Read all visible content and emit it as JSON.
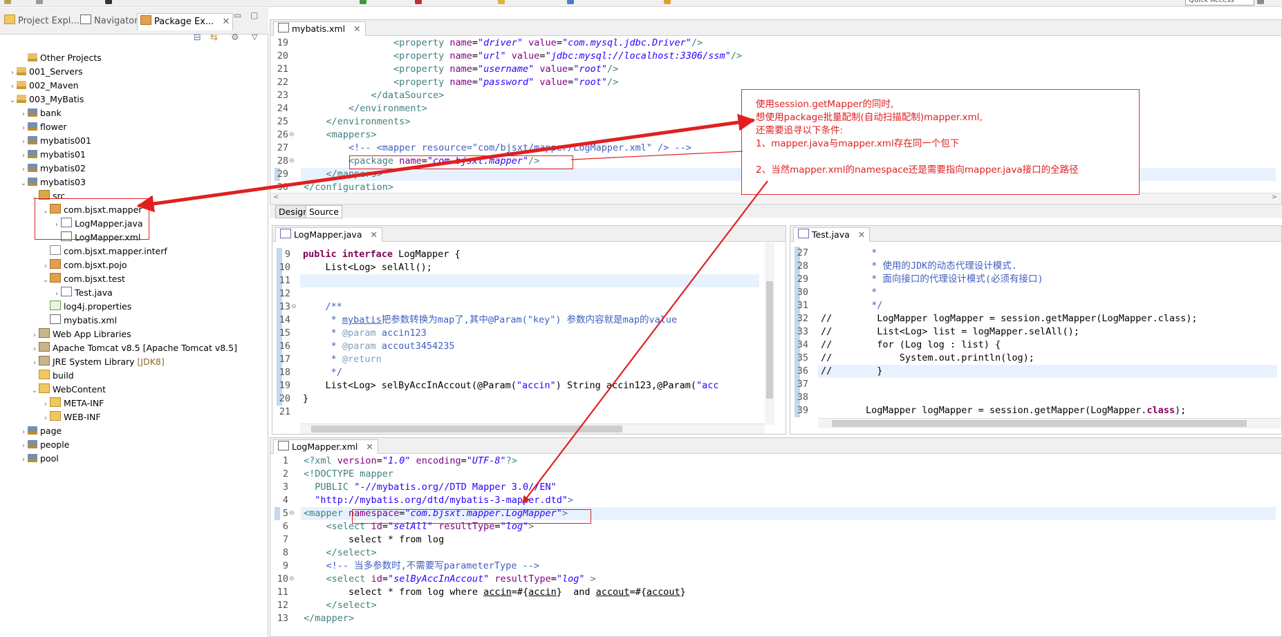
{
  "toolbar": {
    "quick_access": "Quick Access"
  },
  "left_panel": {
    "tabs": [
      {
        "label": "Project Expl...",
        "active": false
      },
      {
        "label": "Navigator",
        "active": false
      },
      {
        "label": "Package Ex...",
        "active": true
      }
    ],
    "tree": [
      {
        "label": "Other Projects",
        "depth": 1,
        "expand": "",
        "icon": "working-set-icon"
      },
      {
        "label": "001_Servers",
        "depth": 0,
        "expand": ">",
        "icon": "project-folder-icon"
      },
      {
        "label": "002_Maven",
        "depth": 0,
        "expand": ">",
        "icon": "project-folder-icon"
      },
      {
        "label": "003_MyBatis",
        "depth": 0,
        "expand": "v",
        "icon": "project-folder-icon"
      },
      {
        "label": "bank",
        "depth": 1,
        "expand": ">",
        "icon": "java-project-icon"
      },
      {
        "label": "flower",
        "depth": 1,
        "expand": ">",
        "icon": "java-project-icon"
      },
      {
        "label": "mybatis001",
        "depth": 1,
        "expand": ">",
        "icon": "java-project-icon"
      },
      {
        "label": "mybatis01",
        "depth": 1,
        "expand": ">",
        "icon": "java-project-icon"
      },
      {
        "label": "mybatis02",
        "depth": 1,
        "expand": ">",
        "icon": "java-project-icon"
      },
      {
        "label": "mybatis03",
        "depth": 1,
        "expand": "v",
        "icon": "java-project-icon"
      },
      {
        "label": "src",
        "depth": 2,
        "expand": "v",
        "icon": "source-folder-icon"
      },
      {
        "label": "com.bjsxt.mapper",
        "depth": 3,
        "expand": "v",
        "icon": "package-icon"
      },
      {
        "label": "LogMapper.java",
        "depth": 4,
        "expand": ">",
        "icon": "java-file-icon"
      },
      {
        "label": "LogMapper.xml",
        "depth": 4,
        "expand": "",
        "icon": "xml-file-icon"
      },
      {
        "label": "com.bjsxt.mapper.interf",
        "depth": 3,
        "expand": "",
        "icon": "empty-package-icon"
      },
      {
        "label": "com.bjsxt.pojo",
        "depth": 3,
        "expand": ">",
        "icon": "package-icon"
      },
      {
        "label": "com.bjsxt.test",
        "depth": 3,
        "expand": "v",
        "icon": "package-icon"
      },
      {
        "label": "Test.java",
        "depth": 4,
        "expand": ">",
        "icon": "java-file-icon"
      },
      {
        "label": "log4j.properties",
        "depth": 3,
        "expand": "",
        "icon": "properties-file-icon"
      },
      {
        "label": "mybatis.xml",
        "depth": 3,
        "expand": "",
        "icon": "xml-file-icon"
      },
      {
        "label": "Web App Libraries",
        "depth": 2,
        "expand": ">",
        "icon": "library-icon"
      },
      {
        "label": "Apache Tomcat v8.5 [Apache Tomcat v8.5]",
        "depth": 2,
        "expand": ">",
        "icon": "library-icon"
      },
      {
        "label": "JRE System Library",
        "suffix": "[JDK8]",
        "depth": 2,
        "expand": ">",
        "icon": "library-icon"
      },
      {
        "label": "build",
        "depth": 2,
        "expand": "",
        "icon": "folder-icon"
      },
      {
        "label": "WebContent",
        "depth": 2,
        "expand": "v",
        "icon": "folder-icon"
      },
      {
        "label": "META-INF",
        "depth": 3,
        "expand": ">",
        "icon": "folder-icon"
      },
      {
        "label": "WEB-INF",
        "depth": 3,
        "expand": ">",
        "icon": "folder-icon"
      },
      {
        "label": "page",
        "depth": 1,
        "expand": ">",
        "icon": "java-project-icon"
      },
      {
        "label": "people",
        "depth": 1,
        "expand": ">",
        "icon": "java-project-icon"
      },
      {
        "label": "pool",
        "depth": 1,
        "expand": ">",
        "icon": "java-project-icon"
      }
    ]
  },
  "editors": {
    "mybatis_xml": {
      "tab": "mybatis.xml",
      "lines": [
        {
          "n": "19",
          "html": "                <span class=\"tag\">&lt;property</span> <span class=\"attr\">name</span>=<span class=\"str\">\"driver\"</span> <span class=\"attr\">value</span>=<span class=\"str\">\"com.mysql.jdbc.Driver\"</span><span class=\"tag\">/&gt;</span>"
        },
        {
          "n": "20",
          "html": "                <span class=\"tag\">&lt;property</span> <span class=\"attr\">name</span>=<span class=\"str\">\"url\"</span> <span class=\"attr\">value</span>=<span class=\"str\">\"jdbc:mysql://localhost:3306/ssm\"</span><span class=\"tag\">/&gt;</span>"
        },
        {
          "n": "21",
          "html": "                <span class=\"tag\">&lt;property</span> <span class=\"attr\">name</span>=<span class=\"str\">\"username\"</span> <span class=\"attr\">value</span>=<span class=\"str\">\"root\"</span><span class=\"tag\">/&gt;</span>"
        },
        {
          "n": "22",
          "html": "                <span class=\"tag\">&lt;property</span> <span class=\"attr\">name</span>=<span class=\"str\">\"password\"</span> <span class=\"attr\">value</span>=<span class=\"str\">\"root\"</span><span class=\"tag\">/&gt;</span>"
        },
        {
          "n": "23",
          "html": "            <span class=\"tag\">&lt;/dataSource&gt;</span>"
        },
        {
          "n": "24",
          "html": "        <span class=\"tag\">&lt;/environment&gt;</span>"
        },
        {
          "n": "25",
          "html": "    <span class=\"tag\">&lt;/environments&gt;</span>"
        },
        {
          "n": "26",
          "html": "    <span class=\"tag\">&lt;mappers&gt;</span>"
        },
        {
          "n": "27",
          "html": "        <span class=\"xmlcmt\">&lt;!-- &lt;mapper resource=\"com/bjsxt/mapper/LogMapper.xml\" /&gt; --&gt;</span>"
        },
        {
          "n": "28",
          "html": "        <span class=\"tag\">&lt;package</span> <span class=\"attr\">name</span>=<span class=\"str\">\"com.bjsxt.mapper\"</span><span class=\"tag\">/&gt;</span>"
        },
        {
          "n": "29",
          "html": "    <span class=\"tag\">&lt;/mappers&gt;</span>"
        },
        {
          "n": "30",
          "html": "<span class=\"tag\">&lt;/configuration&gt;</span>"
        }
      ]
    },
    "bottom_tabs": [
      "Design",
      "Source"
    ],
    "logmapper_java": {
      "tab": "LogMapper.java",
      "lines": [
        {
          "n": "9",
          "html": "<span class=\"kw\">public interface</span> LogMapper {"
        },
        {
          "n": "10",
          "html": "    List&lt;Log&gt; selAll();"
        },
        {
          "n": "11",
          "html": ""
        },
        {
          "n": "12",
          "html": ""
        },
        {
          "n": "13",
          "html": "    <span class=\"cmt\">/**</span>"
        },
        {
          "n": "14",
          "html": "<span class=\"cmt\">     * <u>mybatis</u>把参数转换为map了,其中@Param(\"key\") 参数内容就是map的value</span>"
        },
        {
          "n": "15",
          "html": "<span class=\"cmt\">     * <b style=\"color:#7f9fbf;font-weight:normal\">@param</b> accin123</span>"
        },
        {
          "n": "16",
          "html": "<span class=\"cmt\">     * <b style=\"color:#7f9fbf;font-weight:normal\">@param</b> accout3454235</span>"
        },
        {
          "n": "17",
          "html": "<span class=\"cmt\">     * <b style=\"color:#7f9fbf;font-weight:normal\">@return</b></span>"
        },
        {
          "n": "18",
          "html": "<span class=\"cmt\">     */</span>"
        },
        {
          "n": "19",
          "html": "    List&lt;Log&gt; selByAccInAccout(@Param(<span class=\"str\" style=\"font-style:normal\">\"accin\"</span>) String accin123,@Param(<span class=\"str\" style=\"font-style:normal\">\"acc</span>"
        },
        {
          "n": "20",
          "html": "}"
        },
        {
          "n": "21",
          "html": ""
        }
      ]
    },
    "test_java": {
      "tab": "Test.java",
      "lines": [
        {
          "n": "27",
          "html": "<span class=\"cmt\">         *</span>"
        },
        {
          "n": "28",
          "html": "<span class=\"cmt\">         * 使用的JDK的动态代理设计模式.</span>"
        },
        {
          "n": "29",
          "html": "<span class=\"cmt\">         * 面向接口的代理设计模式(必须有接口)</span>"
        },
        {
          "n": "30",
          "html": "<span class=\"cmt\">         *</span>"
        },
        {
          "n": "31",
          "html": "<span class=\"cmt\">         */</span>"
        },
        {
          "n": "32",
          "html": "//        LogMapper logMapper = session.getMapper(LogMapper.class);"
        },
        {
          "n": "33",
          "html": "//        List&lt;Log&gt; list = logMapper.selAll();"
        },
        {
          "n": "34",
          "html": "//        for (Log log : list) {"
        },
        {
          "n": "35",
          "html": "//            System.out.println(log);"
        },
        {
          "n": "36",
          "html": "//        }"
        },
        {
          "n": "37",
          "html": ""
        },
        {
          "n": "38",
          "html": ""
        },
        {
          "n": "39",
          "html": "        LogMapper logMapper = session.getMapper(LogMapper.<span class=\"kw\">class</span>);"
        }
      ]
    },
    "logmapper_xml": {
      "tab": "LogMapper.xml",
      "lines": [
        {
          "n": "1",
          "html": "<span class=\"tag\">&lt;?xml</span> <span class=\"attr\">version</span>=<span class=\"str\">\"1.0\"</span> <span class=\"attr\">encoding</span>=<span class=\"str\">\"UTF-8\"</span><span class=\"tag\">?&gt;</span>"
        },
        {
          "n": "2",
          "html": "<span class=\"tag\">&lt;!DOCTYPE</span> <span class=\"tag\">mapper</span>"
        },
        {
          "n": "3",
          "html": "  <span class=\"tag\">PUBLIC</span> <span class=\"str\" style=\"font-style:normal\">\"-//mybatis.org//DTD Mapper 3.0//EN\"</span>"
        },
        {
          "n": "4",
          "html": "  <span class=\"str\" style=\"font-style:normal\">\"http://mybatis.org/dtd/mybatis-3-mapper.dtd\"</span><span class=\"tag\">&gt;</span>"
        },
        {
          "n": "5",
          "html": "<span class=\"tag\">&lt;mapper</span> <span class=\"attr\">namespace</span>=<span class=\"str\">\"com.bjsxt.mapper.LogMapper\"</span><span class=\"tag\">&gt;</span>"
        },
        {
          "n": "6",
          "html": "    <span class=\"tag\">&lt;select</span> <span class=\"attr\">id</span>=<span class=\"str\">\"selAll\"</span> <span class=\"attr\">resultType</span>=<span class=\"str\">\"log\"</span><span class=\"tag\">&gt;</span>"
        },
        {
          "n": "7",
          "html": "        select * from log"
        },
        {
          "n": "8",
          "html": "    <span class=\"tag\">&lt;/select&gt;</span>"
        },
        {
          "n": "9",
          "html": "    <span class=\"xmlcmt\">&lt;!-- 当多参数时,不需要写parameterType --&gt;</span>"
        },
        {
          "n": "10",
          "html": "    <span class=\"tag\">&lt;select</span> <span class=\"attr\">id</span>=<span class=\"str\">\"selByAccInAccout\"</span> <span class=\"attr\">resultType</span>=<span class=\"str\">\"log\"</span> <span class=\"tag\">&gt;</span>"
        },
        {
          "n": "11",
          "html": "        select * from log where <u>accin</u>=#{<u>accin</u>}  and <u>accout</u>=#{<u>accout</u>}"
        },
        {
          "n": "12",
          "html": "    <span class=\"tag\">&lt;/select&gt;</span>"
        },
        {
          "n": "13",
          "html": "<span class=\"tag\">&lt;/mapper&gt;</span>"
        }
      ]
    }
  },
  "annotation": {
    "lines": [
      "使用session.getMapper的同时,",
      "想使用package批量配制(自动扫描配制)mapper.xml,",
      "还需要追寻以下条件:",
      "1、mapper.java与mapper.xml存在同一个包下",
      "",
      "2、当然mapper.xml的namespace还是需要指向mapper.java接口的全路径"
    ]
  },
  "colors": {
    "annotation_red": "#e02020",
    "line_highlight": "#e8f2fe"
  }
}
